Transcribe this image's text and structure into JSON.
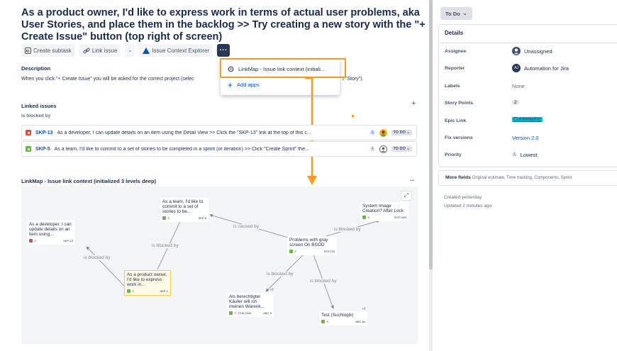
{
  "issue": {
    "title": "As a product owner, I'd like to express work in terms of actual user problems, aka User Stories, and place them in the backlog >> Try creating a new story with the \"+ Create Issue\" button (top right of screen)"
  },
  "toolbar": {
    "create_subtask": "Create subtask",
    "link_issue": "Link issue",
    "context_explorer": "Issue Context Explorer",
    "more": "..."
  },
  "description": {
    "heading": "Description",
    "text_left": "When you click \"+ Create Issue\" you will be asked for the correct project (selec",
    "text_right": "t \"Story\")."
  },
  "dropdown": {
    "items": [
      "LinkMap - Issue link context (initiali...",
      "Add apps"
    ]
  },
  "linked_issues": {
    "heading": "Linked issues",
    "add": "+",
    "relation": "is blocked by",
    "rows": [
      {
        "key": "SKP-13",
        "summary": "As a developer, I can update details on an item using the Detail View >> Click the \"SKP-13\" link at the top of this c...",
        "status": "TO DO",
        "type_color": "#e5493a"
      },
      {
        "key": "SKP-5",
        "summary": "As a team, I'd like to commit to a set of stories to be completed in a sprint (or iteration) >> Click \"Create Sprint\" the...",
        "status": "TO DO",
        "type_color": "#63ba3c"
      }
    ]
  },
  "linkmap": {
    "heading": "LinkMap - Issue link context (initialized 3 levels deep)",
    "more": "...",
    "expand": "⤢",
    "nodes": [
      {
        "text": "As a team, I'd like to commit to a set of stories to be...",
        "key": "SKP-5",
        "color": "#63ba3c"
      },
      {
        "text": "As a developer, I can update details on an item using...",
        "key": "SKP-13",
        "color": "#e5493a"
      },
      {
        "text": "As a product owner, I'd like to express work in...",
        "key": "SKP-1",
        "color": "#63ba3c"
      },
      {
        "text": "System Image Creation? After Lock",
        "key": "TEST-653",
        "color": "#63ba3c"
      },
      {
        "text": "Problems with gray screen On BSOD",
        "key": "TEST-63",
        "color": "#63ba3c"
      },
      {
        "text": "Als berechtigter Käufer will ich meinen Warenk...",
        "key": "ABC-9",
        "color": "#63ba3c",
        "extra": "TCM-2040"
      },
      {
        "text": "Test (Suchlogik)",
        "key": "ABC-6s",
        "color": "#63ba3c"
      }
    ],
    "edge_labels": [
      "is blocked by",
      "is blocked by",
      "is caused by",
      "is blocked by",
      "is blocked by",
      "is blocked by"
    ],
    "counts": [
      "+8",
      "+6"
    ]
  },
  "sidebar": {
    "status": "To Do",
    "details_heading": "Details",
    "fields": [
      {
        "label": "Assignee",
        "value": "Unassigned"
      },
      {
        "label": "Reporter",
        "value": "Automation for Jira",
        "initials": "AJ"
      },
      {
        "label": "Labels",
        "value": "None"
      },
      {
        "label": "Story Points",
        "value": "2"
      },
      {
        "label": "Epic Link",
        "value": "Customizing"
      },
      {
        "label": "Fix versions",
        "value": "Version 2.0"
      },
      {
        "label": "Priority",
        "value": "Lowest"
      }
    ],
    "more_fields_label": "More fields",
    "more_fields_hint": "Original estimate, Time tracking, Components, Sprint",
    "created": "Created yesterday",
    "updated": "Updated 2 minutes ago"
  },
  "colors": {
    "accent_orange": "#f79a1e",
    "link_blue": "#0052cc",
    "epic_bg": "#00c7e6"
  }
}
